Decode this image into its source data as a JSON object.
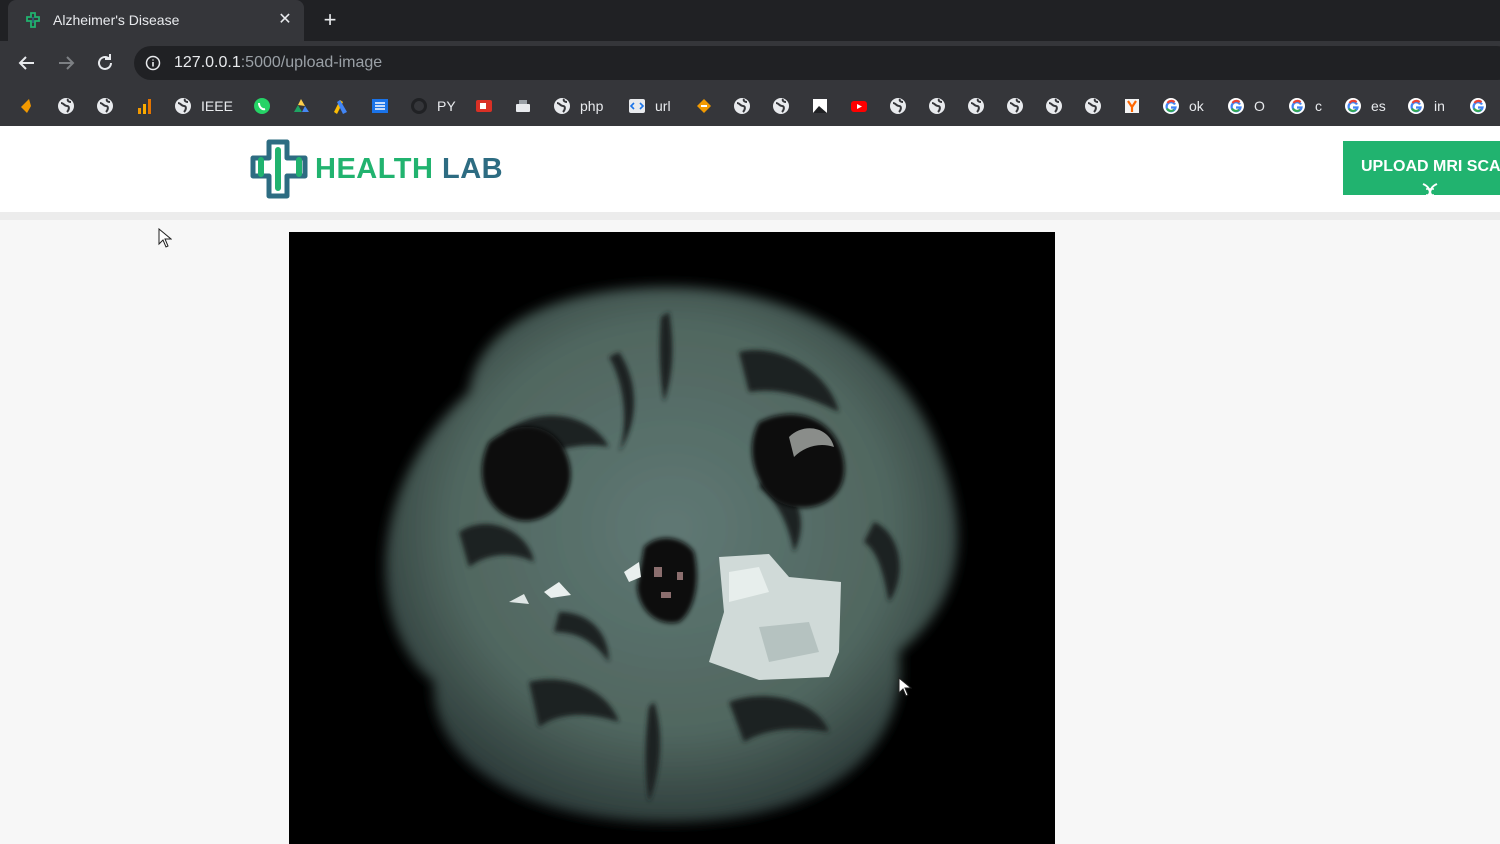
{
  "browser": {
    "tab": {
      "title": "Alzheimer's Disease",
      "close": "✕",
      "favicon": "health-lab-favicon"
    },
    "new_tab": "+",
    "url": {
      "host": "127.0.0.1",
      "path": ":5000/upload-image"
    },
    "bookmarks": [
      {
        "icon": "orange-leaf-icon",
        "label": ""
      },
      {
        "icon": "globe-icon",
        "label": ""
      },
      {
        "icon": "globe-icon",
        "label": ""
      },
      {
        "icon": "bar-chart-icon",
        "label": ""
      },
      {
        "icon": "globe-icon",
        "label": "IEEE"
      },
      {
        "icon": "whatsapp-icon",
        "label": ""
      },
      {
        "icon": "drive-icon",
        "label": ""
      },
      {
        "icon": "ads-icon",
        "label": ""
      },
      {
        "icon": "ieee-icon",
        "label": ""
      },
      {
        "icon": "github-icon",
        "label": "PY"
      },
      {
        "icon": "red-app-icon",
        "label": ""
      },
      {
        "icon": "printer-icon",
        "label": ""
      },
      {
        "icon": "globe-icon",
        "label": "php"
      },
      {
        "icon": "code-icon",
        "label": "url"
      },
      {
        "icon": "orange-app-icon",
        "label": ""
      },
      {
        "icon": "globe-icon",
        "label": ""
      },
      {
        "icon": "globe-icon",
        "label": ""
      },
      {
        "icon": "image-icon",
        "label": ""
      },
      {
        "icon": "youtube-icon",
        "label": ""
      },
      {
        "icon": "globe-icon",
        "label": ""
      },
      {
        "icon": "globe-icon",
        "label": ""
      },
      {
        "icon": "globe-icon",
        "label": ""
      },
      {
        "icon": "globe-icon",
        "label": ""
      },
      {
        "icon": "globe-icon",
        "label": ""
      },
      {
        "icon": "globe-icon",
        "label": ""
      },
      {
        "icon": "y-combinator-icon",
        "label": ""
      },
      {
        "icon": "google-icon",
        "label": "ok"
      },
      {
        "icon": "google-icon",
        "label": "O"
      },
      {
        "icon": "google-icon",
        "label": "c"
      },
      {
        "icon": "google-icon",
        "label": "es"
      },
      {
        "icon": "google-icon",
        "label": "in"
      },
      {
        "icon": "google-icon",
        "label": ""
      }
    ]
  },
  "site": {
    "logo_part1": "HEALTH",
    "logo_part2": "LAB",
    "upload_button": "UPLOAD MRI SCAN",
    "scan_image": "brain-mri-scan"
  },
  "colors": {
    "brand_green": "#21b36f",
    "brand_teal": "#2d6c82",
    "chrome_dark": "#202124",
    "chrome_mid": "#35363a"
  }
}
